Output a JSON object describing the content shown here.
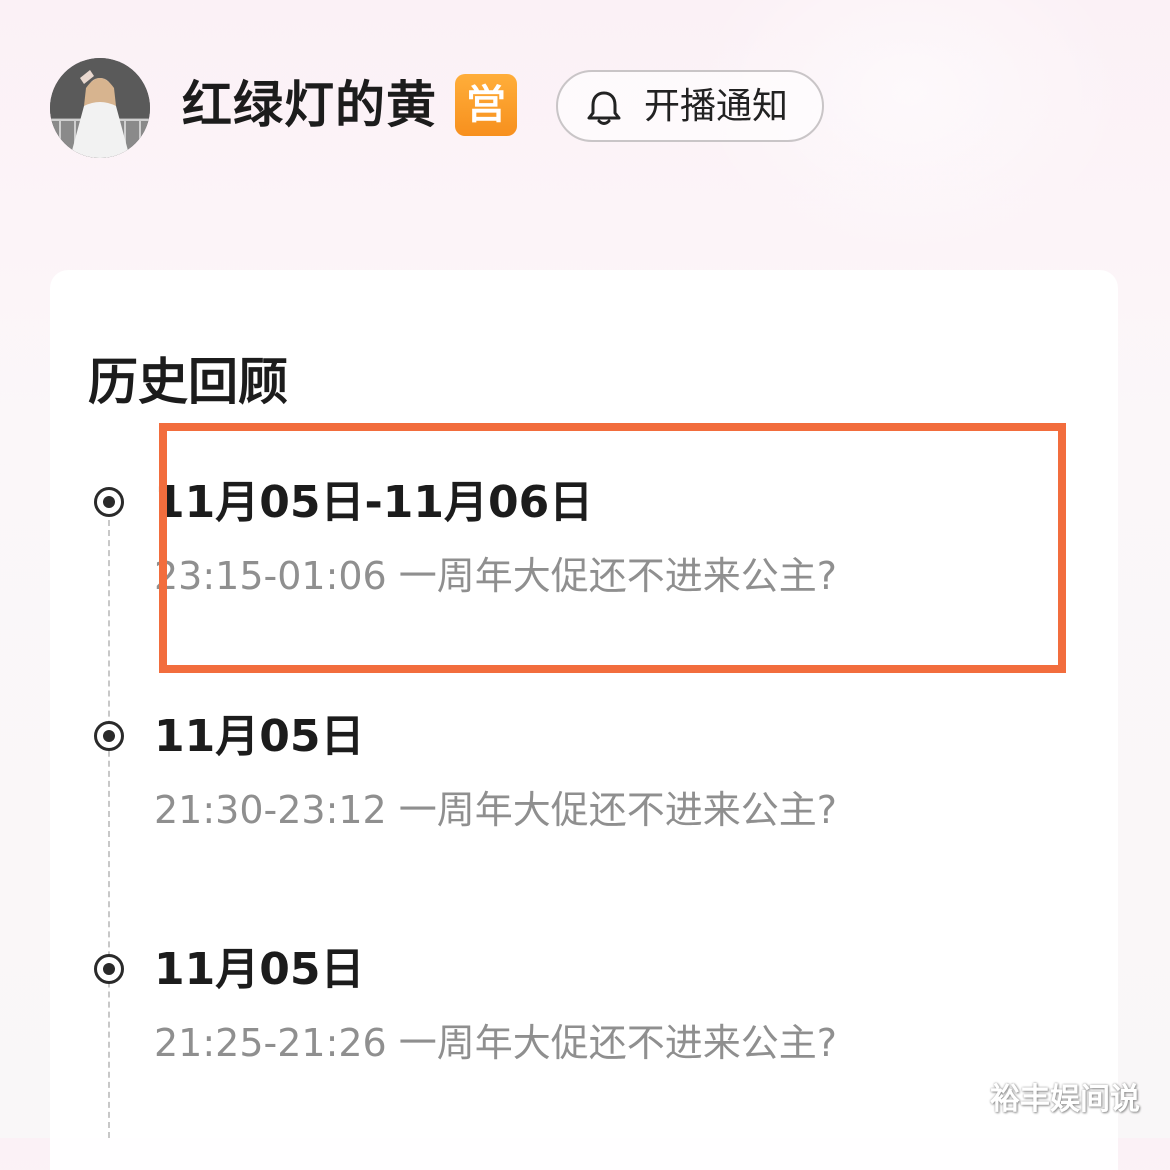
{
  "header": {
    "anchor_name": "红绿灯的黄",
    "badge_text": "営",
    "notify_label": "开播通知",
    "icons": {
      "notify": "bell-icon",
      "badge": "merchant-badge"
    }
  },
  "history": {
    "title": "历史回顾",
    "items": [
      {
        "date": "11月05日-11月06日",
        "desc": "23:15-01:06 一周年大促还不进来公主?"
      },
      {
        "date": "11月05日",
        "desc": "21:30-23:12 一周年大促还不进来公主?"
      },
      {
        "date": "11月05日",
        "desc": "21:25-21:26 一周年大促还不进来公主?"
      }
    ]
  },
  "annotation": {
    "highlight_color": "#f26d3d"
  },
  "watermark": "裕丰娱间说",
  "colors": {
    "badge": "#f7901e",
    "title_text": "#1c1c1c",
    "secondary_text": "#8f8f8f"
  }
}
